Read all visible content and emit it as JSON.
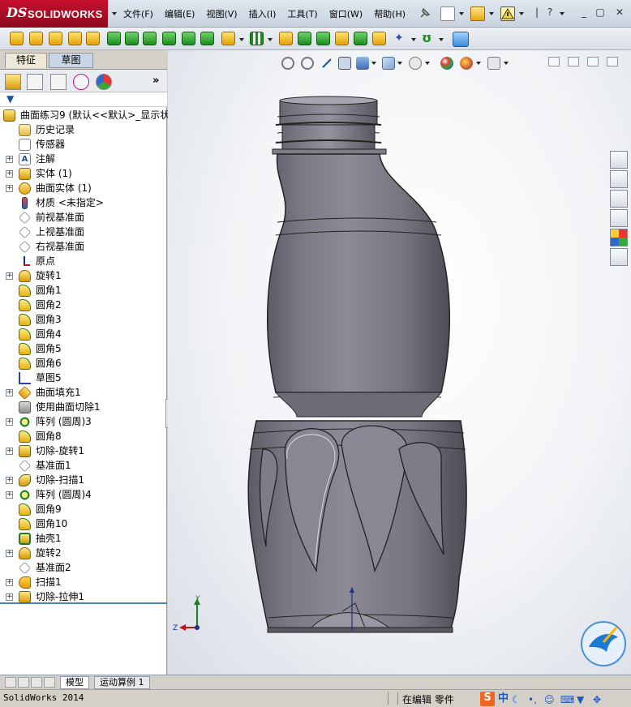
{
  "app": {
    "name": "SOLIDWORKS",
    "logo_ds": "DS"
  },
  "menu": [
    "文件(F)",
    "编辑(E)",
    "视图(V)",
    "插入(I)",
    "工具(T)",
    "窗口(W)",
    "帮助(H)"
  ],
  "panel_tabs": {
    "features": "特征",
    "sketch": "草图"
  },
  "tree": {
    "root": "曲面练习9  (默认<<默认>_显示状",
    "items": [
      {
        "label": "历史记录",
        "icon": "history-folder-icon",
        "expand": false
      },
      {
        "label": "传感器",
        "icon": "sensor-icon",
        "expand": false
      },
      {
        "label": "注解",
        "icon": "annotation-icon",
        "expand": true
      },
      {
        "label": "实体 (1)",
        "icon": "solid-bodies-icon",
        "expand": true
      },
      {
        "label": "曲面实体 (1)",
        "icon": "surface-bodies-icon",
        "expand": true
      },
      {
        "label": "材质 <未指定>",
        "icon": "material-icon",
        "expand": false
      },
      {
        "label": "前视基准面",
        "icon": "plane-icon",
        "expand": false
      },
      {
        "label": "上视基准面",
        "icon": "plane-icon",
        "expand": false
      },
      {
        "label": "右视基准面",
        "icon": "plane-icon",
        "expand": false
      },
      {
        "label": "原点",
        "icon": "origin-icon",
        "expand": false
      },
      {
        "label": "旋转1",
        "icon": "revolve-icon",
        "expand": true
      },
      {
        "label": "圆角1",
        "icon": "fillet-icon",
        "expand": false
      },
      {
        "label": "圆角2",
        "icon": "fillet-icon",
        "expand": false
      },
      {
        "label": "圆角3",
        "icon": "fillet-icon",
        "expand": false
      },
      {
        "label": "圆角4",
        "icon": "fillet-icon",
        "expand": false
      },
      {
        "label": "圆角5",
        "icon": "fillet-icon",
        "expand": false
      },
      {
        "label": "圆角6",
        "icon": "fillet-icon",
        "expand": false
      },
      {
        "label": "草图5",
        "icon": "sketch-icon",
        "expand": false
      },
      {
        "label": "曲面填充1",
        "icon": "fill-surface-icon",
        "expand": true
      },
      {
        "label": "使用曲面切除1",
        "icon": "surface-cut-icon",
        "expand": false
      },
      {
        "label": "阵列 (圆周)3",
        "icon": "circular-pattern-icon",
        "expand": true
      },
      {
        "label": "圆角8",
        "icon": "fillet-icon",
        "expand": false
      },
      {
        "label": "切除-旋转1",
        "icon": "cut-revolve-icon",
        "expand": true
      },
      {
        "label": "基准面1",
        "icon": "plane-icon",
        "expand": false
      },
      {
        "label": "切除-扫描1",
        "icon": "cut-sweep-icon",
        "expand": true
      },
      {
        "label": "阵列 (圆周)4",
        "icon": "circular-pattern-icon",
        "expand": true
      },
      {
        "label": "圆角9",
        "icon": "fillet-icon",
        "expand": false
      },
      {
        "label": "圆角10",
        "icon": "fillet-icon",
        "expand": false
      },
      {
        "label": "抽壳1",
        "icon": "shell-icon",
        "expand": false
      },
      {
        "label": "旋转2",
        "icon": "revolve-icon",
        "expand": true
      },
      {
        "label": "基准面2",
        "icon": "plane-icon",
        "expand": false
      },
      {
        "label": "扫描1",
        "icon": "sweep-icon",
        "expand": true
      },
      {
        "label": "切除-拉伸1",
        "icon": "cut-extrude-icon",
        "expand": true
      }
    ]
  },
  "bottom_tabs": {
    "model": "模型",
    "motion": "运动算例 1"
  },
  "status": {
    "app": "SolidWorks 2014",
    "editing": "在编辑 零件"
  },
  "ime": {
    "sogou": "S",
    "lang": "中"
  },
  "triad": {
    "y": "Y",
    "z": "Z"
  },
  "colors": {
    "accent": "#c8102e",
    "tree_divider": "#4a7fc1",
    "bottle": "#6e6b76"
  }
}
